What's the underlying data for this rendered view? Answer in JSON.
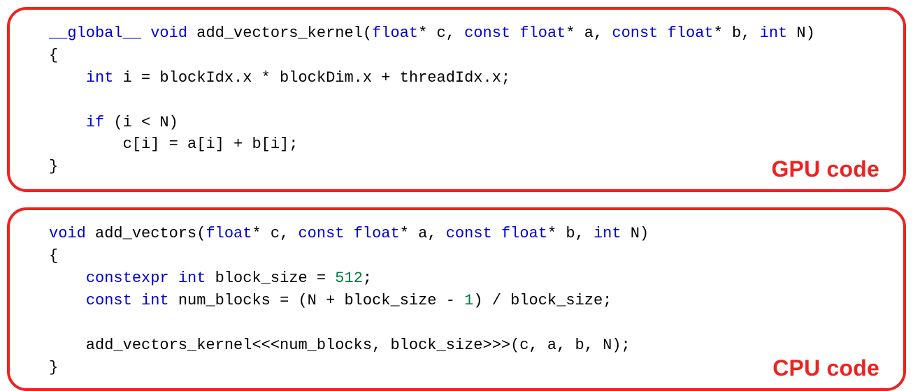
{
  "gpu_block": {
    "label": "GPU code",
    "tokens": [
      {
        "t": "__global__",
        "c": "kw"
      },
      {
        "t": " "
      },
      {
        "t": "void",
        "c": "kw"
      },
      {
        "t": " add_vectors_kernel("
      },
      {
        "t": "float",
        "c": "kw"
      },
      {
        "t": "* c, "
      },
      {
        "t": "const",
        "c": "kw"
      },
      {
        "t": " "
      },
      {
        "t": "float",
        "c": "kw"
      },
      {
        "t": "* a, "
      },
      {
        "t": "const",
        "c": "kw"
      },
      {
        "t": " "
      },
      {
        "t": "float",
        "c": "kw"
      },
      {
        "t": "* b, "
      },
      {
        "t": "int",
        "c": "kw"
      },
      {
        "t": " N)\n"
      },
      {
        "t": "{\n"
      },
      {
        "t": "    "
      },
      {
        "t": "int",
        "c": "kw"
      },
      {
        "t": " i = blockIdx.x * blockDim.x + threadIdx.x;\n"
      },
      {
        "t": "\n"
      },
      {
        "t": "    "
      },
      {
        "t": "if",
        "c": "kw"
      },
      {
        "t": " (i < N)\n"
      },
      {
        "t": "        c[i] = a[i] + b[i];\n"
      },
      {
        "t": "}"
      }
    ]
  },
  "cpu_block": {
    "label": "CPU code",
    "tokens": [
      {
        "t": "void",
        "c": "kw"
      },
      {
        "t": " add_vectors("
      },
      {
        "t": "float",
        "c": "kw"
      },
      {
        "t": "* c, "
      },
      {
        "t": "const",
        "c": "kw"
      },
      {
        "t": " "
      },
      {
        "t": "float",
        "c": "kw"
      },
      {
        "t": "* a, "
      },
      {
        "t": "const",
        "c": "kw"
      },
      {
        "t": " "
      },
      {
        "t": "float",
        "c": "kw"
      },
      {
        "t": "* b, "
      },
      {
        "t": "int",
        "c": "kw"
      },
      {
        "t": " N)\n"
      },
      {
        "t": "{\n"
      },
      {
        "t": "    "
      },
      {
        "t": "constexpr",
        "c": "kw"
      },
      {
        "t": " "
      },
      {
        "t": "int",
        "c": "kw"
      },
      {
        "t": " block_size = "
      },
      {
        "t": "512",
        "c": "num"
      },
      {
        "t": ";\n"
      },
      {
        "t": "    "
      },
      {
        "t": "const",
        "c": "kw"
      },
      {
        "t": " "
      },
      {
        "t": "int",
        "c": "kw"
      },
      {
        "t": " num_blocks = (N + block_size - "
      },
      {
        "t": "1",
        "c": "num"
      },
      {
        "t": ") / block_size;\n"
      },
      {
        "t": "\n"
      },
      {
        "t": "    add_vectors_kernel<<<num_blocks, block_size>>>(c, a, b, N);\n"
      },
      {
        "t": "}"
      }
    ]
  }
}
